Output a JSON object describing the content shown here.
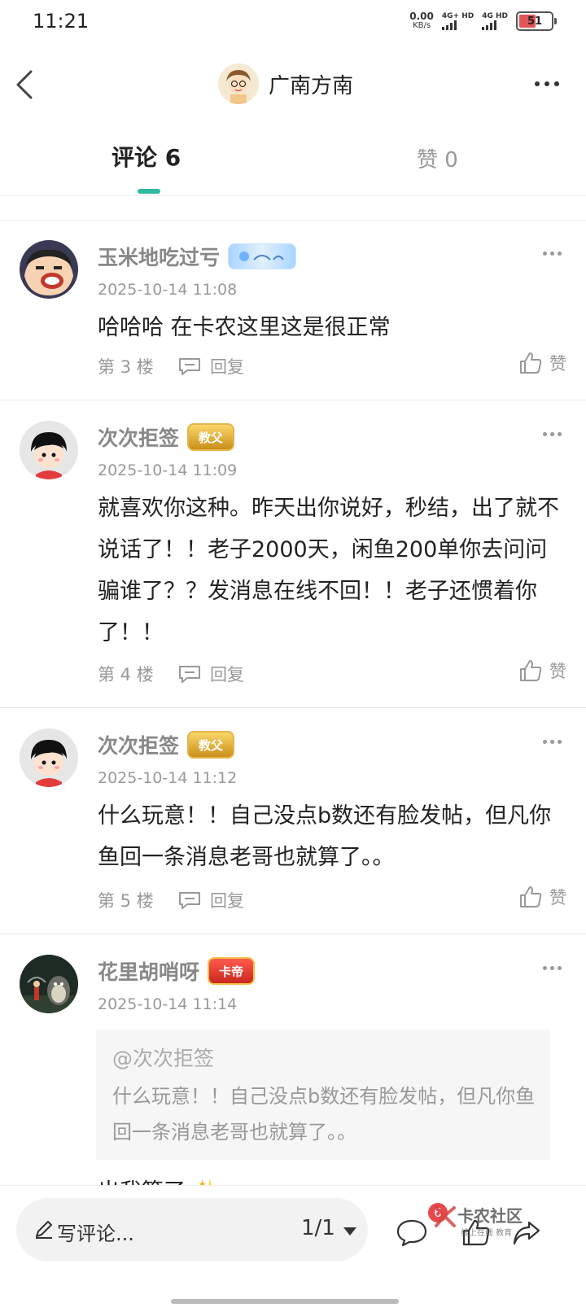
{
  "status_bar": {
    "time": "11:21",
    "net_speed_value": "0.00",
    "net_speed_unit": "KB/s",
    "signal_1": "4G+ HD",
    "signal_2": "4G HD",
    "battery": "51"
  },
  "nav": {
    "title": "广南方南",
    "back_icon": "chevron-left-icon",
    "more_icon": "more-horizontal-icon"
  },
  "tabs": {
    "comments_label": "评论 6",
    "likes_label": "赞 0"
  },
  "comments": [
    {
      "username": "玉米地吃过亏",
      "badge": "",
      "timestamp": "2025-10-14 11:08",
      "text": "哈哈哈 在卡农这里这是很正常",
      "floor": "第 3 楼",
      "reply_label": "回复",
      "like_label": "赞"
    },
    {
      "username": "次次拒签",
      "badge": "教父",
      "timestamp": "2025-10-14 11:09",
      "text": "就喜欢你这种。昨天出你说好，秒结，出了就不说话了！！老子2000天，闲鱼200单你去问问骗谁了？？发消息在线不回！！老子还惯着你了！！",
      "floor": "第 4 楼",
      "reply_label": "回复",
      "like_label": "赞"
    },
    {
      "username": "次次拒签",
      "badge": "教父",
      "timestamp": "2025-10-14 11:12",
      "text": "什么玩意！！自己没点b数还有脸发帖，但凡你鱼回一条消息老哥也就算了。。",
      "floor": "第 5 楼",
      "reply_label": "回复",
      "like_label": "赞"
    },
    {
      "username": "花里胡哨呀",
      "badge": "卡帝",
      "timestamp": "2025-10-14 11:14",
      "quote_user": "@次次拒签",
      "quote_text": "什么玩意！！自己没点b数还有脸发帖，但凡你鱼回一条消息老哥也就算了。。",
      "text_partial": "出我算了 ✨"
    }
  ],
  "bottom_bar": {
    "write_comment_placeholder": "写评论...",
    "page_indicator": "1/1",
    "comment_count_badge": "6",
    "watermark_title": "卡农社区",
    "watermark_sub": "线上在线 教育"
  },
  "colors": {
    "accent": "#2fb9a1",
    "muted_text": "#999999",
    "badge_red": "#e8484b"
  }
}
